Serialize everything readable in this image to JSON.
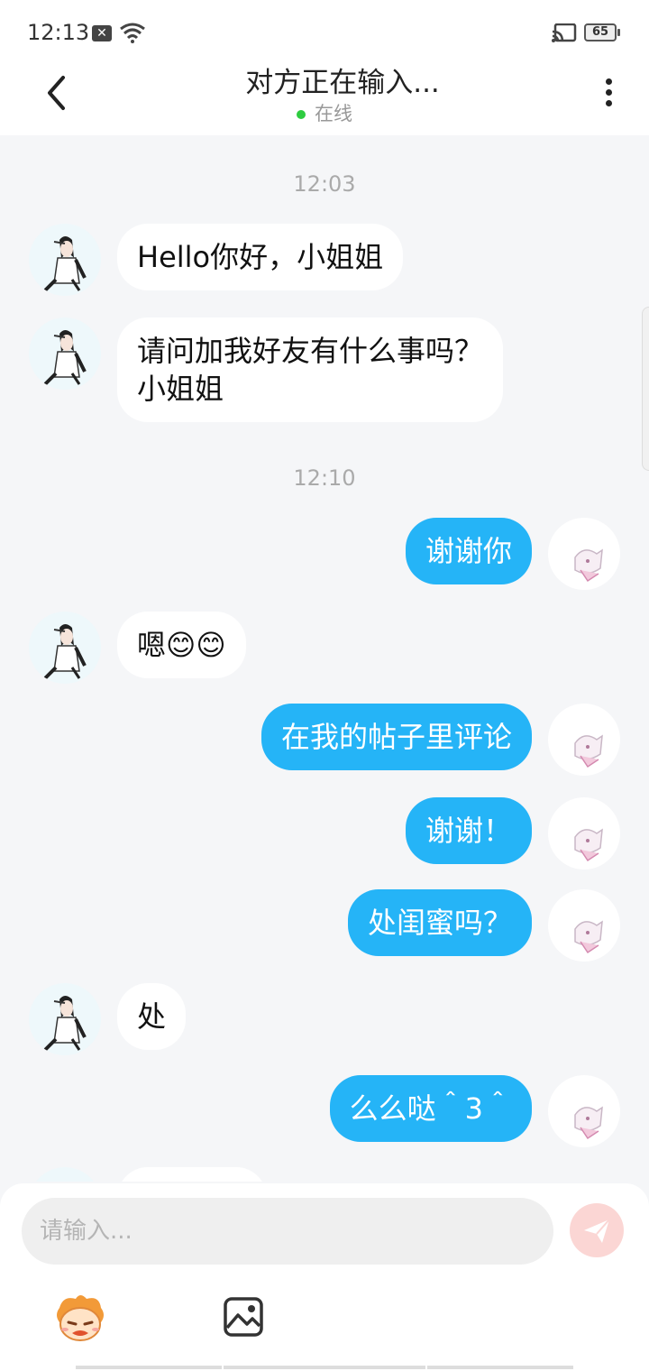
{
  "status_bar": {
    "time": "12:13",
    "battery": "65"
  },
  "header": {
    "title": "对方正在输入...",
    "status": "在线"
  },
  "messages": [
    {
      "type": "time",
      "text": "12:03"
    },
    {
      "type": "other",
      "text": "Hello你好，小姐姐"
    },
    {
      "type": "other",
      "text": "请问加我好友有什么事吗？\n小姐姐"
    },
    {
      "type": "time",
      "text": "12:10"
    },
    {
      "type": "self",
      "text": "谢谢你"
    },
    {
      "type": "other",
      "text": "嗯😊😊"
    },
    {
      "type": "self",
      "text": "在我的帖子里评论"
    },
    {
      "type": "self",
      "text": "谢谢！"
    },
    {
      "type": "self",
      "text": "处闺蜜吗？"
    },
    {
      "type": "other",
      "text": "处"
    },
    {
      "type": "self",
      "text": "么么哒＾3＾"
    }
  ],
  "input": {
    "placeholder": "请输入..."
  },
  "colors": {
    "self_bubble": "#25b4f7",
    "other_bubble": "#ffffff",
    "online": "#2ecc40",
    "send_button": "#fbd6d4"
  },
  "icons": [
    "back-arrow-icon",
    "more-vertical-icon",
    "send-icon",
    "emoji-face-icon",
    "image-icon"
  ]
}
